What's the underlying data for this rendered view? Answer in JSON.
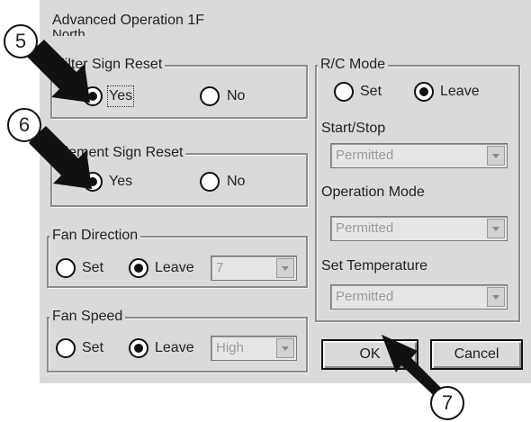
{
  "window": {
    "title": "Advanced Operation 1F",
    "subtitle": "North"
  },
  "filter_sign_reset": {
    "label": "Filter Sign Reset",
    "yes": "Yes",
    "no": "No",
    "selected": "yes"
  },
  "element_sign_reset": {
    "label": "Element Sign Reset",
    "yes": "Yes",
    "no": "No",
    "selected": "yes"
  },
  "fan_direction": {
    "label": "Fan Direction",
    "set": "Set",
    "leave": "Leave",
    "selected": "leave",
    "value": "7"
  },
  "fan_speed": {
    "label": "Fan Speed",
    "set": "Set",
    "leave": "Leave",
    "selected": "leave",
    "value": "High"
  },
  "rc_mode": {
    "label": "R/C Mode",
    "set": "Set",
    "leave": "Leave",
    "selected": "leave"
  },
  "start_stop": {
    "label": "Start/Stop",
    "value": "Permitted"
  },
  "operation_mode": {
    "label": "Operation Mode",
    "value": "Permitted"
  },
  "set_temperature": {
    "label": "Set Temperature",
    "value": "Permitted"
  },
  "buttons": {
    "ok": "OK",
    "cancel": "Cancel"
  },
  "callouts": {
    "step5": "5",
    "step6": "6",
    "step7": "7"
  }
}
